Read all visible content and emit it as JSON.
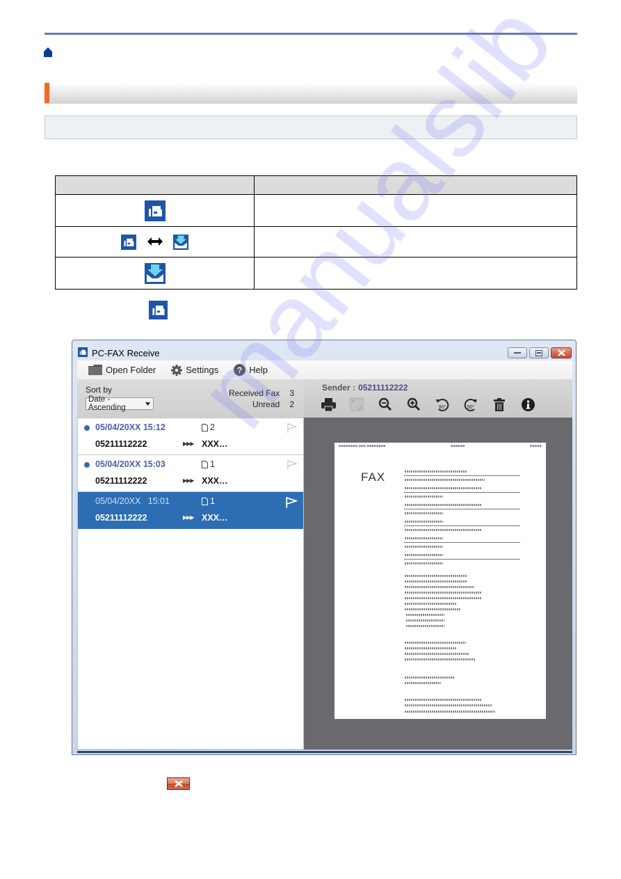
{
  "page": {
    "home_icon": "home-icon",
    "section_title": "",
    "note_text": ""
  },
  "icon_table": {
    "headers": [
      "",
      ""
    ],
    "rows": [
      {
        "icons": [
          "pc-fax-receive-standby-icon"
        ],
        "description": ""
      },
      {
        "icons": [
          "pc-fax-receive-standby-icon",
          "double-arrow-icon",
          "pc-fax-receive-new-fax-icon"
        ],
        "description": ""
      },
      {
        "icons": [
          "pc-fax-receive-new-fax-icon"
        ],
        "description": ""
      }
    ]
  },
  "window": {
    "title": "PC-FAX Receive",
    "controls": [
      "minimize",
      "maximize",
      "close"
    ],
    "menu": [
      {
        "label": "Open Folder",
        "icon": "folder-icon"
      },
      {
        "label": "Settings",
        "icon": "gear-icon"
      },
      {
        "label": "Help",
        "icon": "help-icon"
      }
    ],
    "sort_label": "Sort by",
    "sort_value": "Date - Ascending",
    "stats": {
      "received_label": "Received Fax",
      "received_count": "3",
      "unread_label": "Unread",
      "unread_count": "2"
    },
    "sender_label": "Sender :",
    "sender_value": "05211112222",
    "tools": [
      "print-icon",
      "fit-page-icon",
      "zoom-out-icon",
      "zoom-in-icon",
      "rotate-left-90-icon",
      "rotate-right-90-icon",
      "delete-icon",
      "info-icon"
    ],
    "rotate_label": "90°",
    "faxes": [
      {
        "date": "05/04/20XX",
        "time": "15:12",
        "pages": "2",
        "number": "05211112222",
        "to": "XXX…",
        "unread": true,
        "selected": false
      },
      {
        "date": "05/04/20XX",
        "time": "15:03",
        "pages": "1",
        "number": "05211112222",
        "to": "XXX…",
        "unread": true,
        "selected": false
      },
      {
        "date": "05/04/20XX",
        "time": "15:01",
        "pages": "1",
        "number": "05211112222",
        "to": "XXX…",
        "unread": false,
        "selected": true
      }
    ],
    "preview": {
      "heading": "FAX"
    }
  },
  "watermark": "manualslib",
  "colors": {
    "accent_orange": "#f26b21",
    "rule_blue": "#6b78b8",
    "selected_row": "#2d6db3",
    "unread_text": "#4a5fb0"
  }
}
